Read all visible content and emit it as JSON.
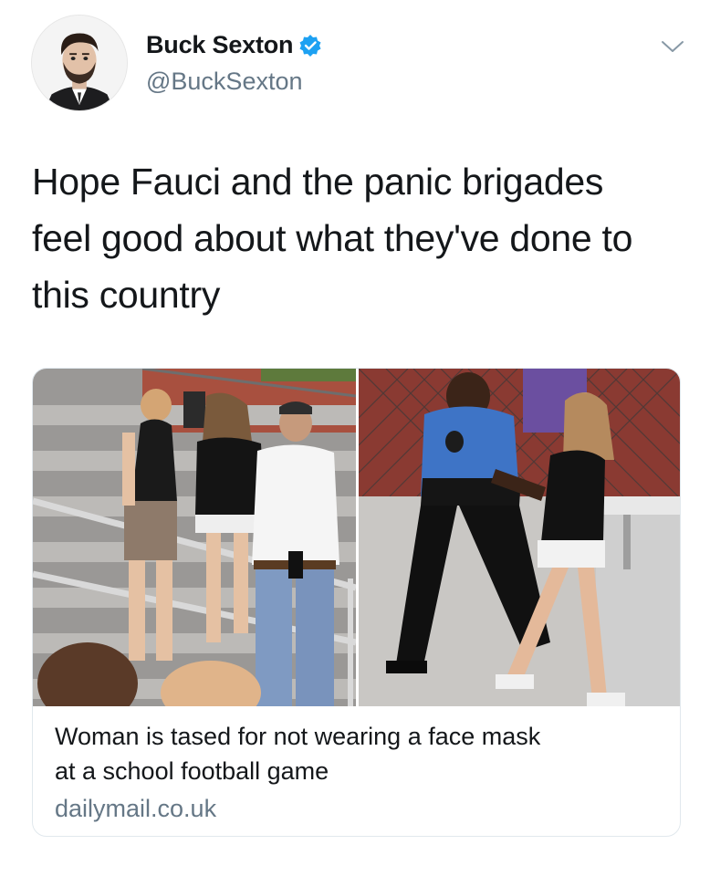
{
  "author": {
    "display_name": "Buck Sexton",
    "handle": "@BuckSexton",
    "verified": true,
    "avatar_icon": "profile-photo",
    "verified_icon": "verified-badge-icon",
    "verified_color": "#1da1f2"
  },
  "menu": {
    "icon": "chevron-down-icon"
  },
  "tweet": {
    "text_lines": [
      "Hope Fauci and the panic brigades",
      "feel good about what they've done to",
      "this country"
    ]
  },
  "card": {
    "title_lines": [
      "Woman is tased for not wearing a face mask",
      "at a school football game"
    ],
    "domain": "dailymail.co.uk",
    "images": [
      "photo-bleachers-scuffle",
      "photo-officer-escort"
    ]
  },
  "colors": {
    "text": "#14171a",
    "secondary": "#657786",
    "border": "#e1e8ed",
    "verified": "#1da1f2"
  }
}
